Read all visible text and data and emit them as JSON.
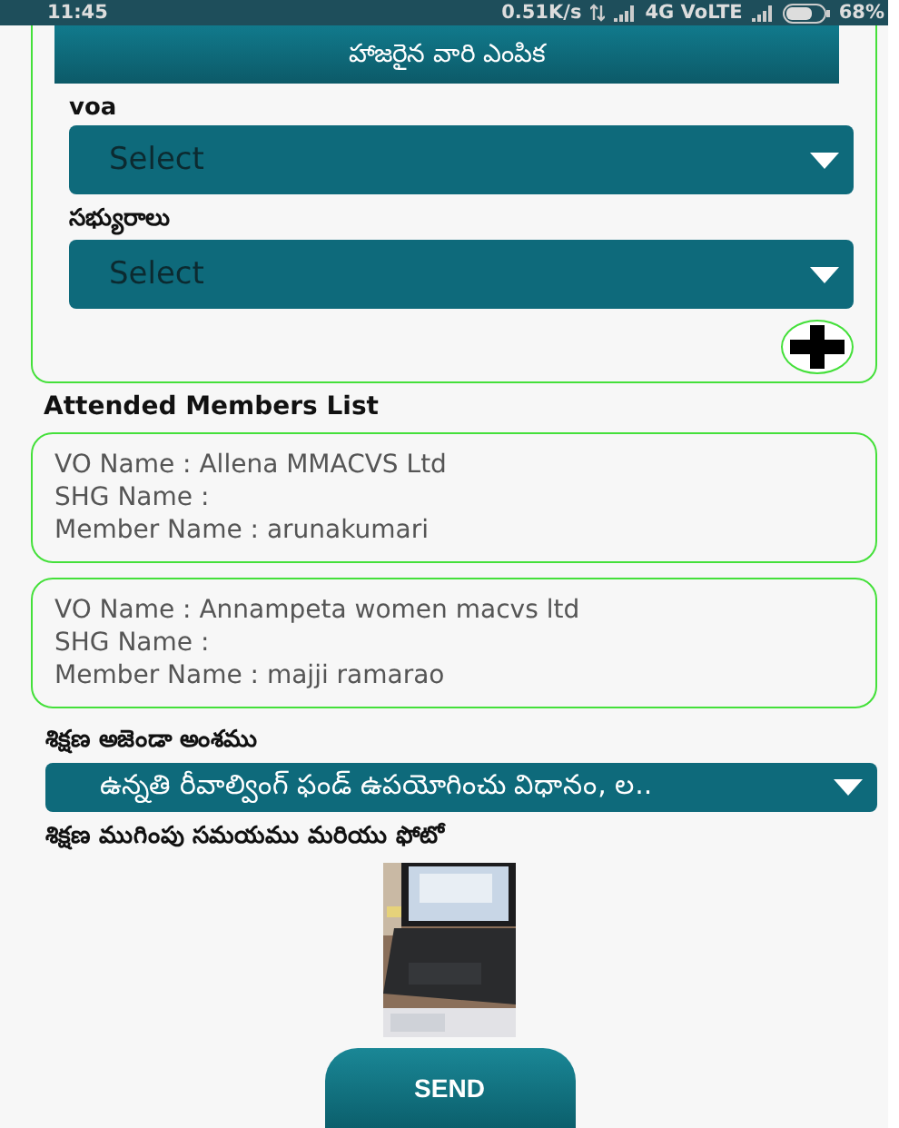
{
  "status_bar": {
    "time": "11:45",
    "speed": "0.51K/s",
    "network": "4G VoLTE",
    "battery": "68%"
  },
  "attendance_card": {
    "title": "హాజరైన వారి ఎంపిక",
    "fields": [
      {
        "label": "voa",
        "value": "Select"
      },
      {
        "label": "సభ్యురాలు",
        "value": "Select"
      }
    ]
  },
  "attended_list": {
    "title": "Attended Members List",
    "members": [
      {
        "lines": [
          "VO Name : Allena MMACVS Ltd",
          "SHG Name :",
          "Member Name : arunakumari"
        ]
      },
      {
        "lines": [
          "VO Name : Annampeta women macvs ltd",
          "SHG Name :",
          "Member Name : majji ramarao"
        ]
      }
    ]
  },
  "agenda": {
    "label": "శిక్షణ అజెండా అంశము",
    "value": "ఉన్నతి రీవాల్వింగ్ ఫండ్ ఉపయోగించు విధానం, ల.."
  },
  "photo": {
    "label": "శిక్షణ ముగింపు సమయము మరియు ఫోటో",
    "kind": "picture"
  },
  "send_button": "SEND"
}
